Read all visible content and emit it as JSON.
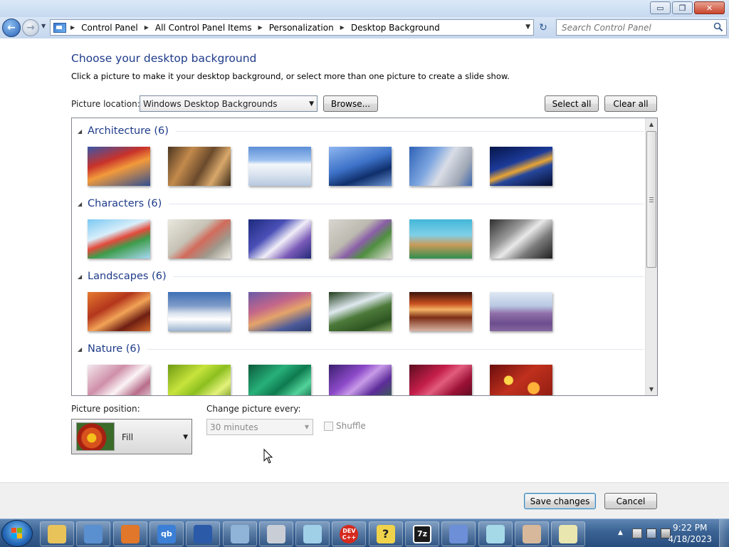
{
  "window": {
    "buttons": {
      "minimize": "▭",
      "restore": "❐",
      "close": "✕"
    }
  },
  "address": {
    "breadcrumbs": [
      "Control Panel",
      "All Control Panel Items",
      "Personalization",
      "Desktop Background"
    ],
    "search_placeholder": "Search Control Panel"
  },
  "page": {
    "heading": "Choose your desktop background",
    "subheading": "Click a picture to make it your desktop background, or select more than one picture to create a slide show.",
    "location_label": "Picture location:",
    "location_value": "Windows Desktop Backgrounds",
    "browse_label": "Browse...",
    "select_all_label": "Select all",
    "clear_all_label": "Clear all"
  },
  "gallery": {
    "groups": [
      {
        "title": "Architecture (6)",
        "thumbs": [
          "linear-gradient(160deg,#3a56a8 0%,#c9322a 35%,#f29a3b 55%,#2f4e92 100%)",
          "linear-gradient(120deg,#4a3520 0%,#c38a4c 30%,#6a4a2c 55%,#d9a86b 75%,#3b2a18 100%)",
          "linear-gradient(180deg,#5d8fd6 0%,#9fc3f0 35%,#f4f7fb 45%,#dbe4f0 70%,#b7c9e0 100%)",
          "linear-gradient(160deg,#8fb7f0 0%,#3d72c8 45%,#0f2f6b 70%,#6c95d4 100%)",
          "linear-gradient(120deg,#2f62b6 0%,#7da6e0 35%,#d9dde6 55%,#a0a8b5 80%,#3c66b0 100%)",
          "linear-gradient(160deg,#061448 0%,#1c3b9a 40%,#e8a534 55%,#26479c 65%,#050d30 100%)"
        ]
      },
      {
        "title": "Characters (6)",
        "thumbs": [
          "linear-gradient(160deg,#7bc8f2 0%,#d8eefa 35%,#e24a3c 50%,#3e9c4b 65%,#a9d9f5 100%)",
          "linear-gradient(140deg,#e9e7df 0%,#c6c2b5 40%,#d26b5c 55%,#9e9a8d 75%,#eceae2 100%)",
          "linear-gradient(140deg,#1d2a7e 0%,#4a4fb6 35%,#f1eef8 55%,#7a5ab8 75%,#222a78 100%)",
          "linear-gradient(140deg,#d8d6cf 0%,#bcb9b0 40%,#8a5fa8 55%,#4f8f3f 70%,#e3e1da 100%)",
          "linear-gradient(180deg,#43b7d9 0%,#7fd0e7 40%,#c99a5a 65%,#2f8e4e 100%)",
          "linear-gradient(140deg,#2f2f2f 0%,#9a9a9a 35%,#e9e9e9 50%,#7a7a7a 70%,#1f1f1f 100%)"
        ]
      },
      {
        "title": "Landscapes (6)",
        "thumbs": [
          "linear-gradient(150deg,#e77a2f 0%,#b3361c 35%,#f2a357 55%,#6e1e12 75%,#d46a2b 100%)",
          "linear-gradient(180deg,#3e6fb5 0%,#7e9bc8 35%,#dbe3ee 55%,#ffffff 70%,#9cb3cf 100%)",
          "linear-gradient(160deg,#6b5aa8 0%,#c3668a 35%,#e5a46a 55%,#4b5a9a 80%,#2b3a6e 100%)",
          "linear-gradient(160deg,#1f3b1a 0%,#dfe9ef 35%,#4d7a3a 55%,#2d5421 80%,#8fb06a 100%)",
          "linear-gradient(180deg,#3b140c 0%,#c9501f 30%,#f3b264 45%,#7c2e16 65%,#d9b4a4 100%)",
          "linear-gradient(180deg,#dfe8f4 0%,#b9c9e3 35%,#8f6fa8 55%,#6c4d8e 80%,#86679f 100%)"
        ]
      },
      {
        "title": "Nature (6)",
        "thumbs": [
          "linear-gradient(140deg,#f3e9ee 0%,#cf8fa8 35%,#fbf4f6 55%,#b86d8a 75%,#efe2e8 100%)",
          "linear-gradient(140deg,#6e9a12 0%,#c7e33c 35%,#8cbf1f 55%,#e3f27a 75%,#5d850f 100%)",
          "linear-gradient(140deg,#0b5a3a 0%,#27b07a 35%,#0e7a4f 55%,#52d39a 75%,#075036 100%)",
          "linear-gradient(140deg,#3a1f6e 0%,#8d4ac9 35%,#c89be8 50%,#5d2c9a 70%,#2e6b3f 100%)",
          "linear-gradient(140deg,#5c0c1f 0%,#c41e4a 35%,#e25c7e 50%,#9c1236 70%,#4a0818 100%)",
          "radial-gradient(circle at 30% 40%,#ffd54a 0 6px,transparent 7px),radial-gradient(circle at 70% 60%,#ffb13a 0 8px,transparent 9px),linear-gradient(140deg,#6b0d0d 0%,#c0301d 45%,#8a1a10 100%)"
        ]
      }
    ]
  },
  "options": {
    "position_label": "Picture position:",
    "position_value": "Fill",
    "change_label": "Change picture every:",
    "change_value": "30 minutes",
    "shuffle_label": "Shuffle"
  },
  "footer": {
    "save_label": "Save changes",
    "cancel_label": "Cancel"
  },
  "taskbar": {
    "items": [
      {
        "name": "explorer-icon",
        "bg": "#e8c35a",
        "glyph": ""
      },
      {
        "name": "control-panel-icon",
        "bg": "#5a8fd0",
        "glyph": ""
      },
      {
        "name": "firefox-icon",
        "bg": "#e0772a",
        "glyph": ""
      },
      {
        "name": "qbittorrent-icon",
        "bg": "#3b7fd6",
        "glyph": "qb"
      },
      {
        "name": "remote-desktop-icon",
        "bg": "#2a5aa8",
        "glyph": ""
      },
      {
        "name": "calculator-icon",
        "bg": "#8fb4d8",
        "glyph": ""
      },
      {
        "name": "printer-icon",
        "bg": "#c9ced6",
        "glyph": ""
      },
      {
        "name": "notepad-icon",
        "bg": "#9fd0e8",
        "glyph": ""
      },
      {
        "name": "devcpp-icon",
        "bg": "#d62a1e",
        "glyph": "DEV C++"
      },
      {
        "name": "help-icon",
        "bg": "#f0d34a",
        "glyph": "?"
      },
      {
        "name": "7zip-icon",
        "bg": "#1a1a1a",
        "glyph": "7z"
      },
      {
        "name": "arrow-app-icon",
        "bg": "#6d8fd8",
        "glyph": ""
      },
      {
        "name": "notes-icon",
        "bg": "#a6d9e8",
        "glyph": ""
      },
      {
        "name": "blocked-app-icon",
        "bg": "#d8b89a",
        "glyph": ""
      },
      {
        "name": "chart-editor-icon",
        "bg": "#e9e6b0",
        "glyph": ""
      }
    ],
    "time": "9:22 PM",
    "date": "4/18/2023"
  }
}
